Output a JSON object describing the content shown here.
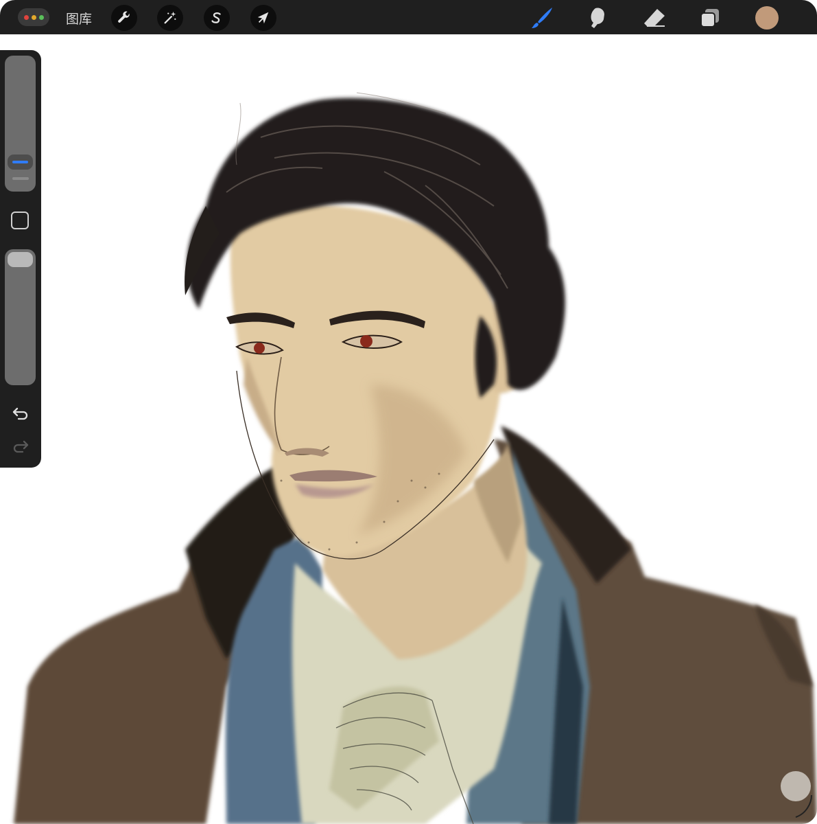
{
  "toolbar": {
    "gallery_label": "图库",
    "window_dots": [
      "#e0443e",
      "#e3a92b",
      "#5ac05a"
    ],
    "left_tools": [
      "wrench-icon",
      "magic-wand-icon",
      "selection-s-icon",
      "arrow-transform-icon"
    ],
    "right_tools": [
      "brush-icon",
      "smudge-icon",
      "eraser-icon",
      "layers-icon"
    ],
    "active_tool": "brush-icon",
    "active_color": "#c19a7a"
  },
  "sidebar": {
    "brush_size_icon": "size-slider",
    "opacity_icon": "opacity-slider",
    "modify_button_icon": "square-icon",
    "undo_icon": "undo-icon",
    "redo_icon": "redo-icon"
  },
  "canvas": {
    "background": "#ffffff",
    "artwork": "painted-portrait"
  }
}
